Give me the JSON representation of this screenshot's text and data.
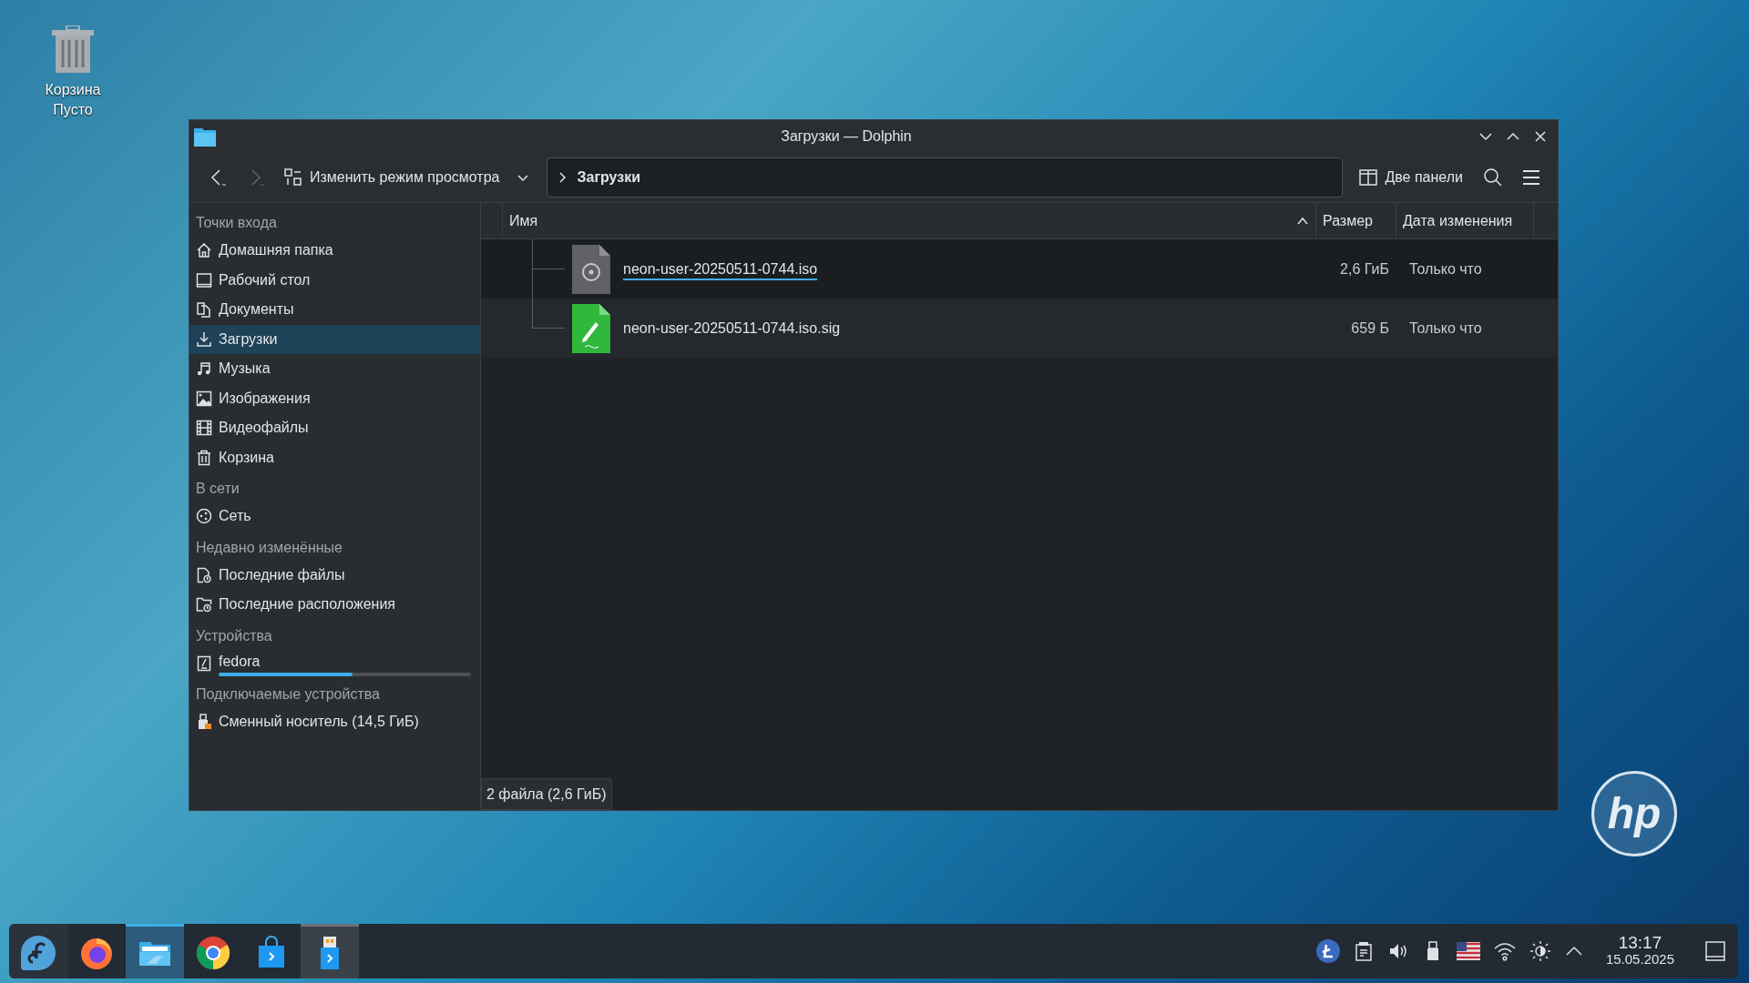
{
  "desktop": {
    "icons": [
      {
        "kind": "trash",
        "label": "Корзина",
        "sublabel": "Пусто"
      }
    ],
    "logo": "hp"
  },
  "window": {
    "title": "Загрузки — Dolphin",
    "toolbar": {
      "back_disabled": false,
      "forward_disabled": true,
      "view_mode": "Изменить режим просмотра",
      "breadcrumb": "Загрузки",
      "split": "Две панели"
    },
    "sidebar": [
      {
        "title": "Точки входа",
        "items": [
          {
            "kind": "home",
            "label": "Домашняя папка",
            "selected": false
          },
          {
            "kind": "desktop",
            "label": "Рабочий стол",
            "selected": false
          },
          {
            "kind": "documents",
            "label": "Документы",
            "selected": false
          },
          {
            "kind": "download",
            "label": "Загрузки",
            "selected": true
          },
          {
            "kind": "music",
            "label": "Музыка",
            "selected": false
          },
          {
            "kind": "image",
            "label": "Изображения",
            "selected": false
          },
          {
            "kind": "video",
            "label": "Видеофайлы",
            "selected": false
          },
          {
            "kind": "trash",
            "label": "Корзина",
            "selected": false
          }
        ]
      },
      {
        "title": "В сети",
        "items": [
          {
            "kind": "network",
            "label": "Сеть",
            "selected": false
          }
        ]
      },
      {
        "title": "Недавно изменённые",
        "items": [
          {
            "kind": "recent-files",
            "label": "Последние файлы",
            "selected": false
          },
          {
            "kind": "recent-places",
            "label": "Последние расположения",
            "selected": false
          }
        ]
      },
      {
        "title": "Устройства",
        "items": [
          {
            "kind": "drive",
            "label": "fedora",
            "selected": false,
            "level": 0.53
          }
        ]
      },
      {
        "title": "Подключаемые устройства",
        "items": [
          {
            "kind": "usb",
            "label": "Сменный носитель (14,5 ГиБ)",
            "selected": false
          }
        ]
      }
    ],
    "columns": [
      {
        "label": "Имя",
        "sorted": true
      },
      {
        "label": "Размер",
        "sorted": false
      },
      {
        "label": "Дата изменения",
        "sorted": false
      }
    ],
    "files": [
      {
        "kind": "iso",
        "name": "neon-user-20250511-0744.iso",
        "size": "2,6 ГиБ",
        "modified": "Только что",
        "focused": true
      },
      {
        "kind": "sig",
        "name": "neon-user-20250511-0744.iso.sig",
        "size": "659 Б",
        "modified": "Только что",
        "focused": false
      }
    ],
    "status": "2 файла (2,6 ГиБ)"
  },
  "taskbar": {
    "apps": [
      {
        "kind": "fedora",
        "selected": false,
        "open": false
      },
      {
        "kind": "firefox",
        "selected": false,
        "open": false
      },
      {
        "kind": "files",
        "selected": true,
        "open": true
      },
      {
        "kind": "chrome",
        "selected": false,
        "open": false
      },
      {
        "kind": "store",
        "selected": false,
        "open": false
      },
      {
        "kind": "usb-writer",
        "selected": false,
        "open": true
      }
    ],
    "time": "13:17",
    "date": "15.05.2025"
  }
}
